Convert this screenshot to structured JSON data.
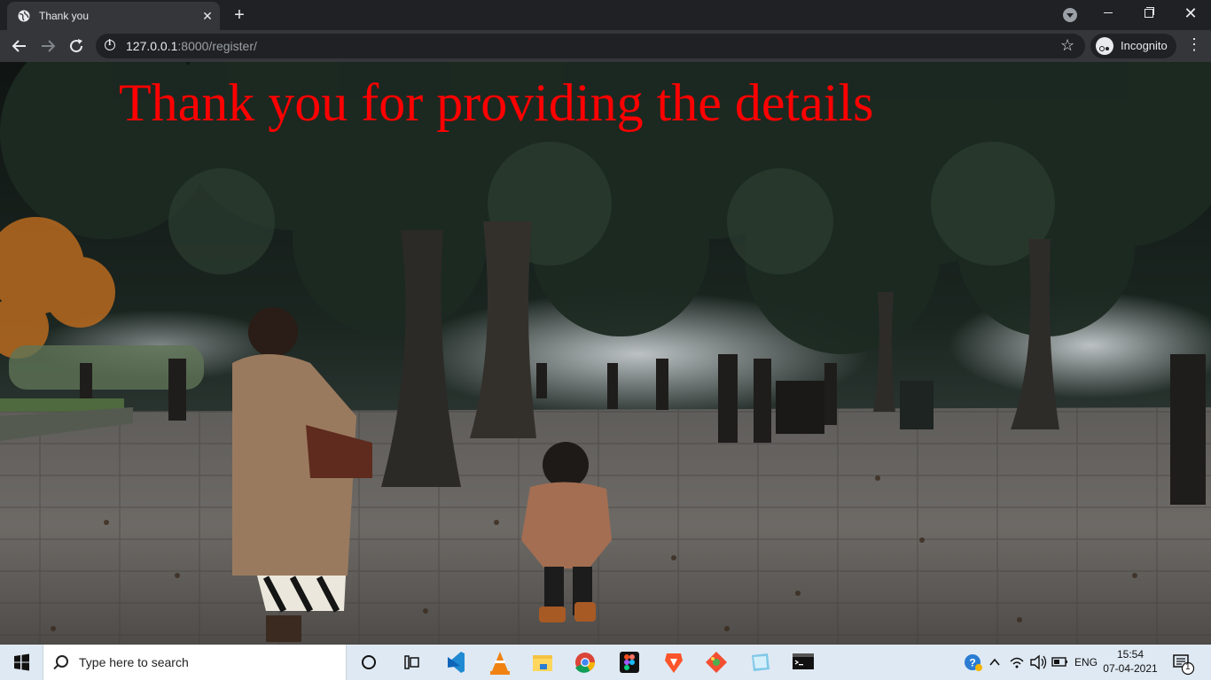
{
  "browser": {
    "tab": {
      "title": "Thank you"
    },
    "url": {
      "host": "127.0.0.1",
      "path": ":8000/register/"
    },
    "profile_label": "Incognito"
  },
  "page": {
    "heading": "Thank you for providing the details",
    "heading_color": "#ff0000"
  },
  "taskbar": {
    "search_placeholder": "Type here to search",
    "pinned": [
      "cortana-icon",
      "task-view-icon",
      "vscode-icon",
      "vlc-icon",
      "file-explorer-icon",
      "chrome-icon",
      "figma-icon",
      "brave-icon",
      "git-icon",
      "notepad-icon",
      "terminal-icon"
    ],
    "language": "ENG",
    "time": "15:54",
    "date": "07-04-2021",
    "notification_count": "1"
  }
}
